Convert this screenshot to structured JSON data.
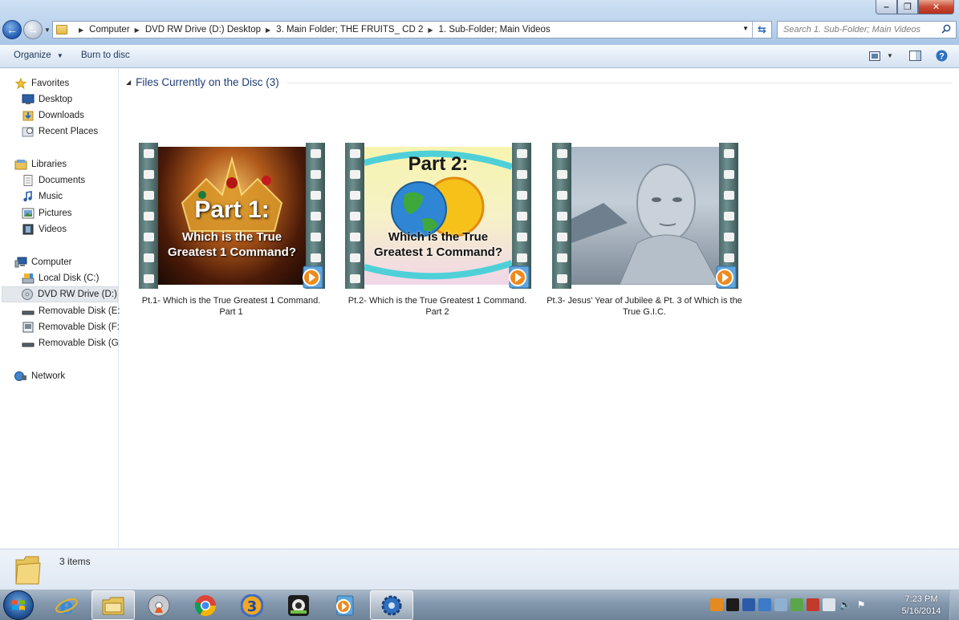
{
  "window": {
    "minimize_icon": "minimize-icon",
    "maximize_icon": "maximize-icon",
    "close_icon": "close-icon",
    "minimize_glyph": "‒",
    "maximize_glyph": "❐",
    "close_glyph": "✕"
  },
  "address": {
    "crumbs": [
      "Computer",
      "DVD RW Drive (D:) Desktop",
      "3. Main Folder; THE FRUITS_ CD 2",
      "1. Sub-Folder; Main Videos"
    ]
  },
  "search": {
    "placeholder": "Search 1. Sub-Folder; Main Videos"
  },
  "toolbar": {
    "organize_label": "Organize",
    "burn_label": "Burn to disc"
  },
  "nav": {
    "favorites": {
      "header": "Favorites",
      "items": [
        "Desktop",
        "Downloads",
        "Recent Places"
      ]
    },
    "libraries": {
      "header": "Libraries",
      "items": [
        "Documents",
        "Music",
        "Pictures",
        "Videos"
      ]
    },
    "computer": {
      "header": "Computer",
      "items": [
        "Local Disk (C:)",
        "DVD RW Drive (D:) D",
        "Removable Disk (E:)",
        "Removable Disk (F:)",
        "Removable Disk (G:)"
      ]
    },
    "network": {
      "header": "Network"
    }
  },
  "content": {
    "group_title": "Files Currently on the Disc (3)",
    "files": [
      {
        "name_line1": "Pt.1- Which is the True Greatest 1 Command.",
        "name_line2": "Part 1",
        "thumb_title": "Part 1:",
        "thumb_sub1": "Which is the True",
        "thumb_sub2": "Greatest 1 Command?"
      },
      {
        "name_line1": "Pt.2- Which is the True Greatest 1 Command.",
        "name_line2": "Part 2",
        "thumb_title": "Part 2:",
        "thumb_sub1": "Which is the True",
        "thumb_sub2": "Greatest 1 Command?"
      },
      {
        "name_line1": "Pt.3- Jesus' Year of Jubilee & Pt. 3 of Which is the",
        "name_line2": "True G.I.C."
      }
    ]
  },
  "status": {
    "item_count": "3 items"
  },
  "taskbar": {
    "time": "7:23 PM",
    "date": "5/16/2014"
  },
  "colors": {
    "accent": "#1e3c75",
    "titlebar": "#bcd4ee",
    "taskbar": "#8397ad"
  }
}
